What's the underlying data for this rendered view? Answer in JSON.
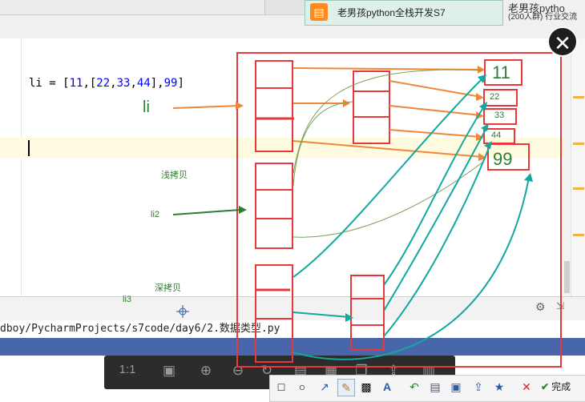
{
  "browser": {
    "qq_card_title": "老男孩python全栈开发S7",
    "qq_right_title": "老男孩pytho",
    "qq_right_sub": "(200人群) 行业交流"
  },
  "editor": {
    "code_prefix": "li = [",
    "code_11": "11",
    "code_mid": ",[",
    "code_22": "22",
    "code_c1": ",",
    "code_33": "33",
    "code_c2": ",",
    "code_44": "44",
    "code_close": "],",
    "code_99": "99",
    "code_end": "]"
  },
  "annotations": {
    "li_label": "li",
    "li2_label": "li2",
    "li3_label": "li3",
    "shallow_copy": "浅拷贝",
    "deep_copy": "深拷贝",
    "val_11": "11",
    "val_22": "22",
    "val_33": "33",
    "val_44": "44",
    "val_99": "99"
  },
  "status": {
    "file_path": "dboy/PycharmProjects/s7code/day6/2.数据类型.py"
  },
  "snip_toolbar": {
    "done_label": "完成"
  },
  "viewer_toolbar": {
    "zoom_ratio": "1:1"
  },
  "colors": {
    "annotation_red": "#e8383d",
    "arrow_orange": "#f0883a",
    "arrow_green": "#2f7d2f",
    "arrow_teal": "#13a89e",
    "line_olive": "#7aa35a"
  }
}
